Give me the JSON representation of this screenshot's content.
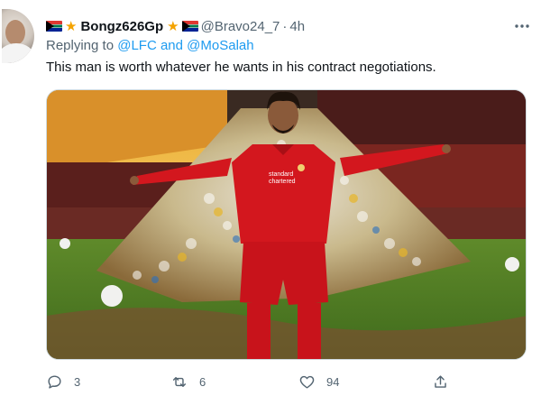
{
  "tweet": {
    "author": {
      "display_name": "Bongz626Gp",
      "handle": "@Bravo24_7",
      "separator": "·",
      "time": "4h",
      "badges": [
        "south-africa-flag-icon",
        "star-icon",
        "star-icon",
        "south-africa-flag-icon"
      ]
    },
    "reply": {
      "prefix": "Replying to",
      "mention1": "@LFC",
      "conjunction": "and",
      "mention2": "@MoSalah"
    },
    "text": "This man is worth whatever he wants in his contract negotiations.",
    "media": {
      "shirt_sponsor_line1": "standard",
      "shirt_sponsor_line2": "chartered"
    },
    "actions": {
      "reply_count": "3",
      "retweet_count": "6",
      "like_count": "94"
    },
    "more_icon": "more-horizontal-icon"
  },
  "colors": {
    "link": "#1d9bf0",
    "muted": "#536471",
    "text": "#0f1419",
    "kit_red": "#d3171e",
    "star": "#f4a300"
  }
}
